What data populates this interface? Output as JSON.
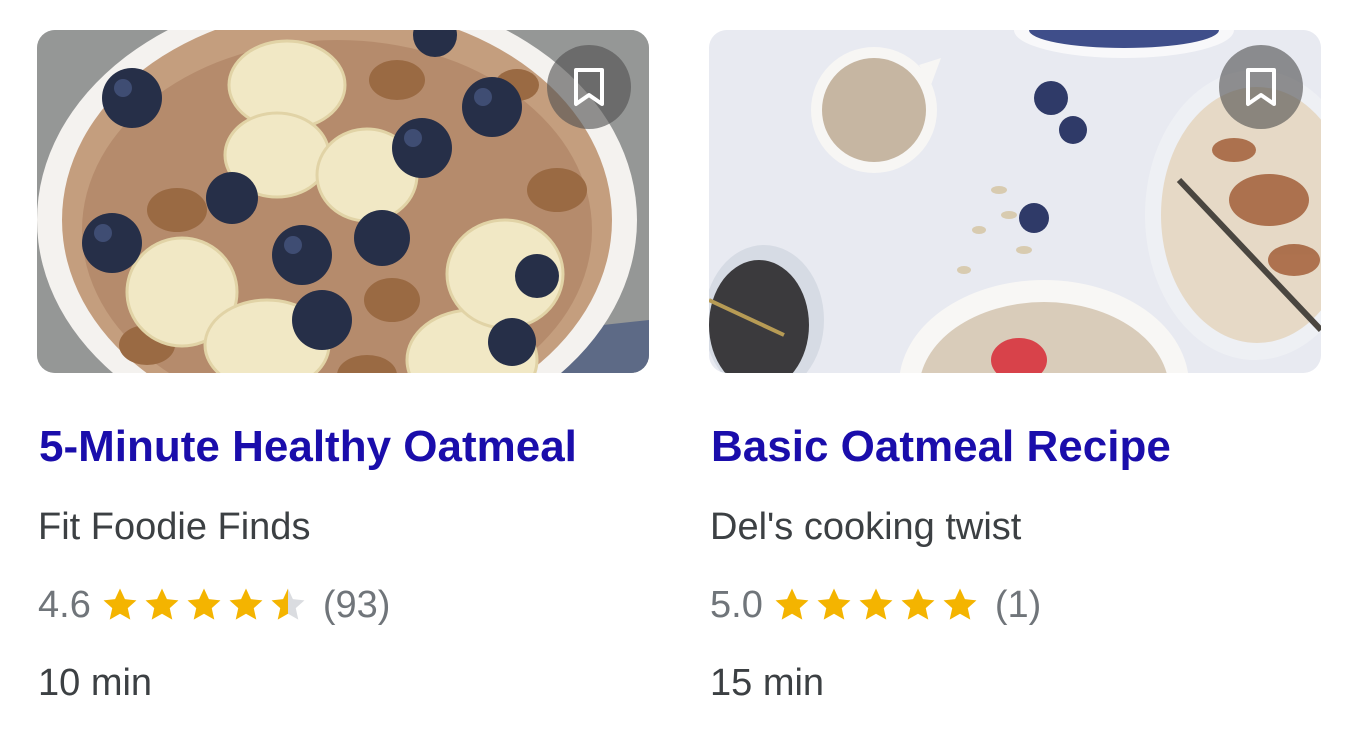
{
  "colors": {
    "title_link": "#1a0dab",
    "source_text": "#3c4043",
    "rating_text": "#70757a",
    "star_filled": "#f4b400",
    "star_empty": "#dadce0"
  },
  "recipes": [
    {
      "title": "5-Minute Healthy Oatmeal",
      "source": "Fit Foodie Finds",
      "rating": "4.6",
      "rating_value": 4.6,
      "review_count": "(93)",
      "time": "10 min",
      "image_subject": "oatmeal bowl with banana slices, blueberries and walnuts",
      "save_icon": "bookmark-icon"
    },
    {
      "title": "Basic Oatmeal Recipe",
      "source": "Del's cooking twist",
      "rating": "5.0",
      "rating_value": 5.0,
      "review_count": "(1)",
      "time": "15 min",
      "image_subject": "oatmeal bowls with cream pitcher, blueberries, chia seeds and strawberry",
      "save_icon": "bookmark-icon"
    }
  ]
}
